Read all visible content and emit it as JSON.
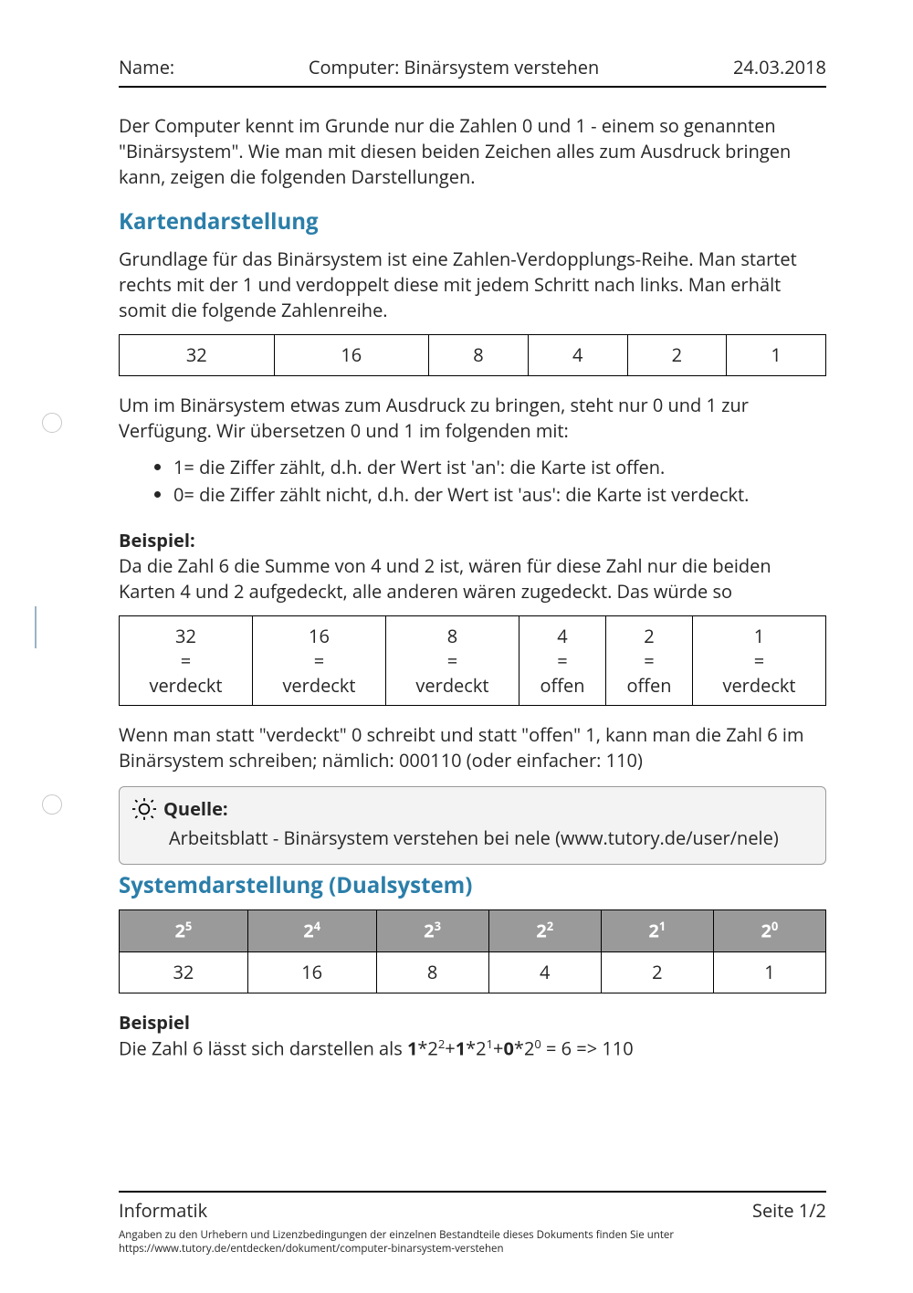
{
  "header": {
    "name_label": "Name:",
    "title": "Computer: Binärsystem verstehen",
    "date": "24.03.2018"
  },
  "intro": "Der Computer kennt im Grunde nur die Zahlen 0 und 1 - einem so genannten \"Binärsystem\". Wie man mit diesen beiden Zeichen alles zum Ausdruck bringen kann, zeigen die folgenden Darstellungen.",
  "section1": {
    "heading": "Kartendarstellung",
    "para1": "Grundlage für das Binärsystem ist eine Zahlen-Verdopplungs-Reihe. Man startet rechts mit der 1 und verdoppelt diese mit jedem Schritt nach links. Man erhält somit die folgende Zahlenreihe.",
    "row": [
      "32",
      "16",
      "8",
      "4",
      "2",
      "1"
    ],
    "para2": "Um im Binärsystem etwas zum Ausdruck zu bringen, steht nur 0 und 1 zur Verfügung. Wir übersetzen 0 und 1 im folgenden mit:",
    "bullets": [
      "1= die Ziffer zählt, d.h. der Wert ist 'an': die Karte ist offen.",
      "0= die Ziffer zählt nicht, d.h. der Wert ist 'aus': die Karte ist verdeckt."
    ],
    "example_label": "Beispiel",
    "example_text": "Da die Zahl 6 die Summe von 4 und 2 ist, wären für diese Zahl nur die beiden Karten 4 und 2 aufgedeckt, alle anderen wären zugedeckt. Das würde so",
    "states": [
      "verdeckt",
      "verdeckt",
      "verdeckt",
      "offen",
      "offen",
      "verdeckt"
    ],
    "para3": "Wenn man statt \"verdeckt\" 0 schreibt und statt \"offen\" 1, kann man die Zahl 6 im Binärsystem schreiben; nämlich: 000110 (oder einfacher: 110)"
  },
  "callout": {
    "title": "Quelle:",
    "body": "Arbeitsblatt -  Binärsystem verstehen bei nele (www.tutory.de/user/nele)"
  },
  "section2": {
    "heading": "Systemdarstellung (Dualsystem)",
    "powers": [
      [
        "2",
        "5"
      ],
      [
        "2",
        "4"
      ],
      [
        "2",
        "3"
      ],
      [
        "2",
        "2"
      ],
      [
        "2",
        "1"
      ],
      [
        "2",
        "0"
      ]
    ],
    "values": [
      "32",
      "16",
      "8",
      "4",
      "2",
      "1"
    ],
    "example_label": "Beispiel",
    "example_prefix": "Die Zahl 6 lässt sich darstellen als ",
    "example_formula_parts": {
      "t1": "1",
      "t2": "*2",
      "e2": "2",
      "t3": "+",
      "t4": "1",
      "t5": "*2",
      "e5": "1",
      "t6": "+",
      "t7": "0",
      "t8": "*2",
      "e8": "0",
      "suffix": " = 6 => 110"
    }
  },
  "footer": {
    "subject": "Informatik",
    "page": "Seite 1/2",
    "small1": "Angaben zu den Urhebern und Lizenzbedingungen der einzelnen Bestandteile dieses Dokuments finden Sie unter",
    "small2": "https://www.tutory.de/entdecken/dokument/computer-binarsystem-verstehen"
  }
}
